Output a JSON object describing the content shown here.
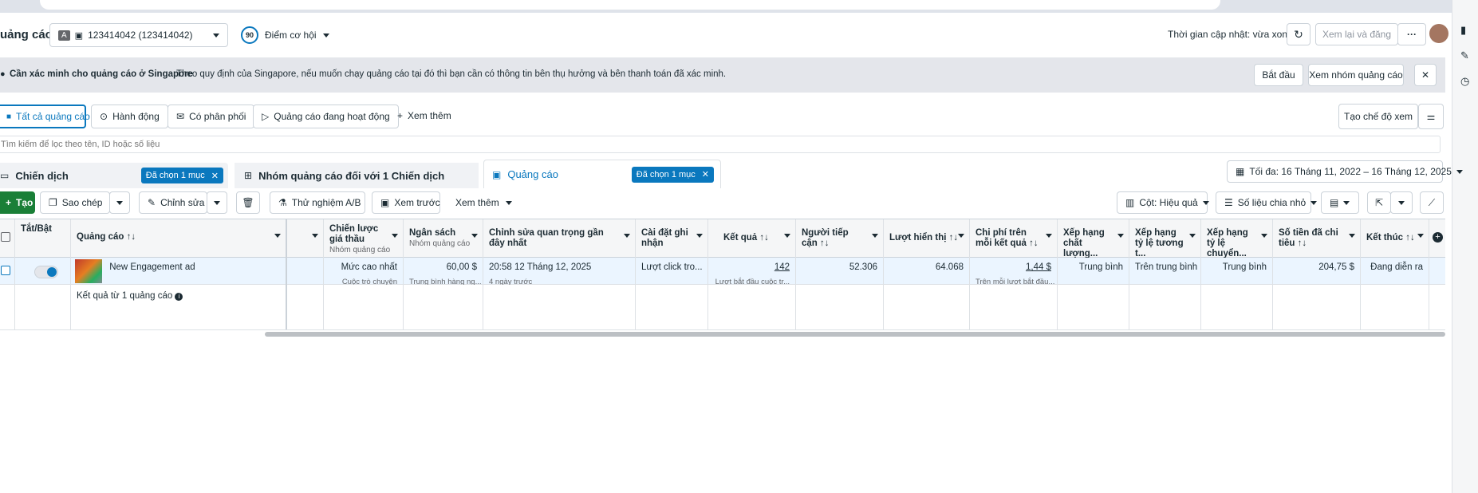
{
  "browser": {
    "url_fragment": "ads/manager/manage/ads/?act=123414042&..."
  },
  "topbar": {
    "title": "uảng cáo",
    "account_badge": "A",
    "account_label": "123414042 (123414042)",
    "score": "90",
    "score_label": "Điểm cơ hội",
    "updated": "Thời gian cập nhật: vừa xong",
    "review_publish": "Xem lại và đăng",
    "more": "···"
  },
  "banner": {
    "title": "Cần xác minh cho quảng cáo ở Singapore",
    "text": "Theo quy định của Singapore, nếu muốn chạy quảng cáo tại đó thì bạn cần có thông tin bên thụ hưởng và bên thanh toán đã xác minh.",
    "start": "Bắt đầu",
    "view_group": "Xem nhóm quảng cáo",
    "close": "✕"
  },
  "filters": {
    "items": [
      "Tất cả quảng cáo",
      "Hành động",
      "Có phân phối",
      "Quảng cáo đang hoạt động"
    ],
    "more": "Xem thêm",
    "create_view": "Tạo chế độ xem"
  },
  "search": {
    "placeholder": "Tìm kiếm để lọc theo tên, ID hoặc số liệu"
  },
  "level_tabs": {
    "campaign": {
      "label": "Chiến dịch",
      "tag": "Đã chọn 1 mục"
    },
    "adset": {
      "label": "Nhóm quảng cáo đối với 1 Chiến dịch"
    },
    "ad": {
      "label": "Quảng cáo",
      "tag": "Đã chọn 1 mục"
    },
    "date_range": "Tối đa: 16 Tháng 11, 2022 – 16 Tháng 12, 2025"
  },
  "toolbar": {
    "create": "Tạo",
    "duplicate": "Sao chép",
    "edit": "Chỉnh sửa",
    "ab_test": "Thử nghiệm A/B",
    "preview": "Xem trước",
    "more": "Xem thêm",
    "columns": "Cột: Hiệu quả",
    "breakdown": "Số liệu chia nhỏ"
  },
  "table": {
    "headers": {
      "toggle": "Tắt/Bật",
      "ad": "Quảng cáo ↑↓",
      "bid": "Chiến lược giá thầu",
      "bid_sub": "Nhóm quảng cáo",
      "budget": "Ngân sách",
      "budget_sub": "Nhóm quảng cáo",
      "last_edit": "Chỉnh sửa quan trọng gần đây nhất",
      "attribution": "Cài đặt ghi nhận",
      "results": "Kết quả ↑↓",
      "reach": "Người tiếp cận ↑↓",
      "impressions": "Lượt hiển thị ↑↓",
      "cpr": "Chi phí trên mỗi kết quả ↑↓",
      "quality": "Xếp hạng chất lượng...",
      "engagement": "Xếp hạng tỷ lệ tương t...",
      "conversion": "Xếp hạng tỷ lệ chuyển...",
      "spent": "Số tiền đã chi tiêu ↑↓",
      "ends": "Kết thúc ↑↓"
    },
    "row": {
      "name": "New Engagement ad",
      "bid": "Mức cao nhất",
      "bid_sub": "Cuộc trò chuyện",
      "budget": "60,00 $",
      "budget_sub": "Trung bình hàng ng...",
      "last_edit": "20:58 12 Tháng 12, 2025",
      "last_edit_sub": "4 ngày trước",
      "attribution": "Lượt click tro...",
      "results": "142",
      "results_sub": "Lượt bắt đầu cuộc tr...",
      "reach": "52.306",
      "impressions": "64.068",
      "cpr": "1,44 $",
      "cpr_sub": "Trên mỗi lượt bắt đầu...",
      "quality": "Trung bình",
      "engagement": "Trên trung bình",
      "conversion": "Trung bình",
      "spent": "204,75 $",
      "ends": "Đang diễn ra"
    },
    "summary": "Kết quả từ 1 quảng cáo"
  }
}
